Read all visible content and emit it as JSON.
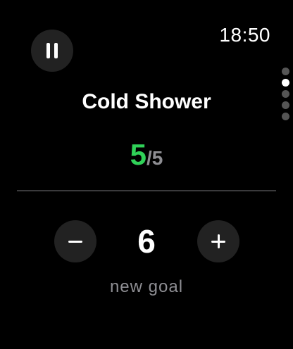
{
  "status": {
    "time": "18:50"
  },
  "controls": {
    "pause_icon": "pause-icon",
    "minus_icon": "minus-icon",
    "plus_icon": "plus-icon"
  },
  "pagination": {
    "total_pages": 5,
    "active_page": 2
  },
  "habit": {
    "title": "Cold Shower",
    "current": "5",
    "separator": "/",
    "total": "5"
  },
  "goal": {
    "value": "6",
    "label": "new goal"
  },
  "colors": {
    "background": "#000000",
    "accent_green": "#30d158",
    "button_fill": "#222222",
    "secondary_text": "#8e8e93"
  }
}
